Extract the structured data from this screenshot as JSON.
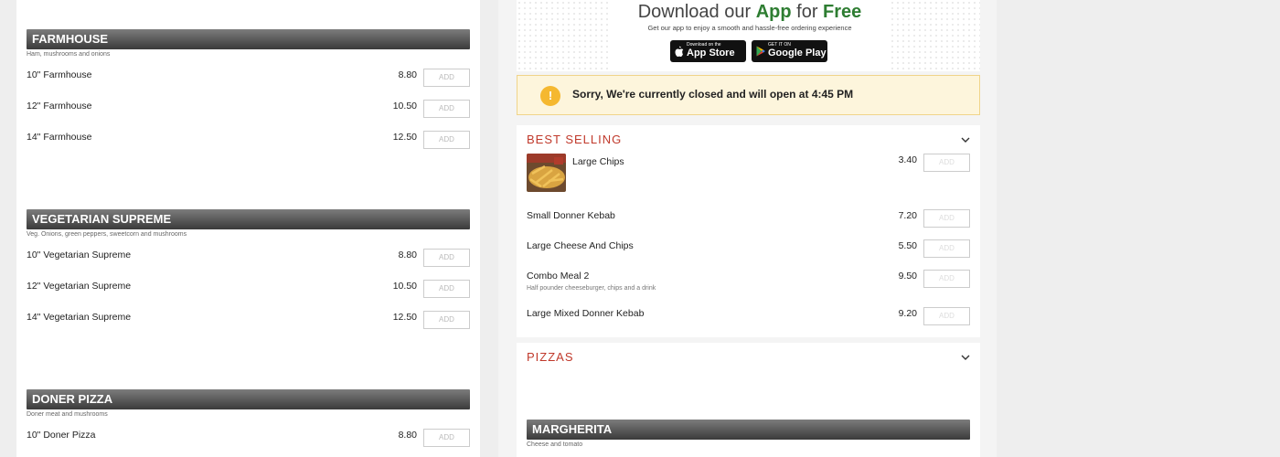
{
  "left": {
    "add_label": "ADD",
    "categories": [
      {
        "title": "FARMHOUSE",
        "description": "Ham, mushrooms and onions",
        "items": [
          {
            "name": "10\" Farmhouse",
            "price": "8.80"
          },
          {
            "name": "12\" Farmhouse",
            "price": "10.50"
          },
          {
            "name": "14\" Farmhouse",
            "price": "12.50"
          }
        ]
      },
      {
        "title": "VEGETARIAN SUPREME",
        "description": "Veg. Onions, green peppers, sweetcorn and mushrooms",
        "items": [
          {
            "name": "10\" Vegetarian Supreme",
            "price": "8.80"
          },
          {
            "name": "12\" Vegetarian Supreme",
            "price": "10.50"
          },
          {
            "name": "14\" Vegetarian Supreme",
            "price": "12.50"
          }
        ]
      },
      {
        "title": "DONER PIZZA",
        "description": "Doner meat and mushrooms",
        "items": [
          {
            "name": "10\" Doner Pizza",
            "price": "8.80"
          }
        ]
      }
    ]
  },
  "app_promo": {
    "title_prefix": "Download our ",
    "title_app": "App",
    "title_for": " for ",
    "title_free": "Free",
    "subtitle": "Get our app to enjoy a smooth and hassle-free ordering experience",
    "appstore_small": "Download on the",
    "appstore_big": "App Store",
    "googleplay_small": "GET IT ON",
    "googleplay_big": "Google Play"
  },
  "closed_notice": {
    "icon": "!",
    "text": "Sorry, We're currently closed and will open at 4:45 PM"
  },
  "best_selling": {
    "title": "BEST SELLING",
    "add_label": "ADD",
    "items": [
      {
        "name": "Large Chips",
        "price": "3.40",
        "description": ""
      },
      {
        "name": "Small Donner Kebab",
        "price": "7.20",
        "description": ""
      },
      {
        "name": "Large Cheese And Chips",
        "price": "5.50",
        "description": ""
      },
      {
        "name": "Combo Meal 2",
        "price": "9.50",
        "description": "Half pounder cheeseburger, chips and a drink"
      },
      {
        "name": "Large Mixed Donner Kebab",
        "price": "9.20",
        "description": ""
      }
    ]
  },
  "pizzas": {
    "title": "PIZZAS",
    "first_category": {
      "title": "MARGHERITA",
      "description": "Cheese and tomato"
    }
  },
  "colors": {
    "section_title": "#c0392b",
    "header_gradient_top": "#7c7c7c",
    "header_gradient_bottom": "#3a3a3a",
    "notice_bg": "#fdf5dc",
    "warn_icon": "#f5b830",
    "free_green": "#2e7d32"
  }
}
